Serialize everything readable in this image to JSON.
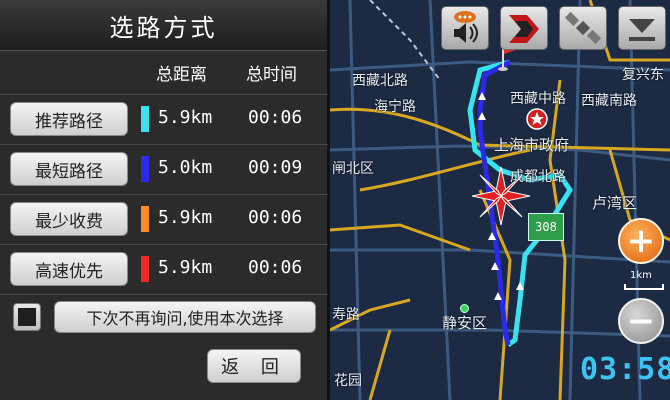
{
  "panel": {
    "title": "选路方式",
    "header_distance": "总距离",
    "header_time": "总时间",
    "routes": [
      {
        "label": "推荐路径",
        "color": "#38e3f0",
        "distance": "5.9km",
        "time": "00:06"
      },
      {
        "label": "最短路径",
        "color": "#2a2ae8",
        "distance": "5.0km",
        "time": "00:09"
      },
      {
        "label": "最少收费",
        "color": "#ff8a2a",
        "distance": "5.9km",
        "time": "00:06"
      },
      {
        "label": "高速优先",
        "color": "#f02a2a",
        "distance": "5.9km",
        "time": "00:06"
      }
    ],
    "dont_ask_label": "下次不再询问,使用本次选择",
    "dont_ask_checked": false,
    "back_label": "返 回"
  },
  "map": {
    "labels": {
      "xizang_bei": "西藏北路",
      "haining": "海宁路",
      "xizang_zhong": "西藏中路",
      "xizang_nan": "西藏南路",
      "fuxing": "复兴东",
      "city_hall": "上海市政府",
      "chengdu_bei": "成都北路",
      "zhabei": "闸北区",
      "luwan": "卢湾区",
      "jingan": "静安区",
      "huayuan": "花园",
      "yanan": "寿路"
    },
    "speed_marker": "308",
    "scale_label": "1km",
    "clock": "03:58"
  },
  "icons": {
    "sound": "speaker-icon",
    "destination": "destination-flag-icon",
    "satellite": "satellite-icon",
    "menu": "download-arrow-icon",
    "compass": "compass-rose-icon",
    "zoom_in": "plus-icon",
    "zoom_out": "minus-icon"
  }
}
